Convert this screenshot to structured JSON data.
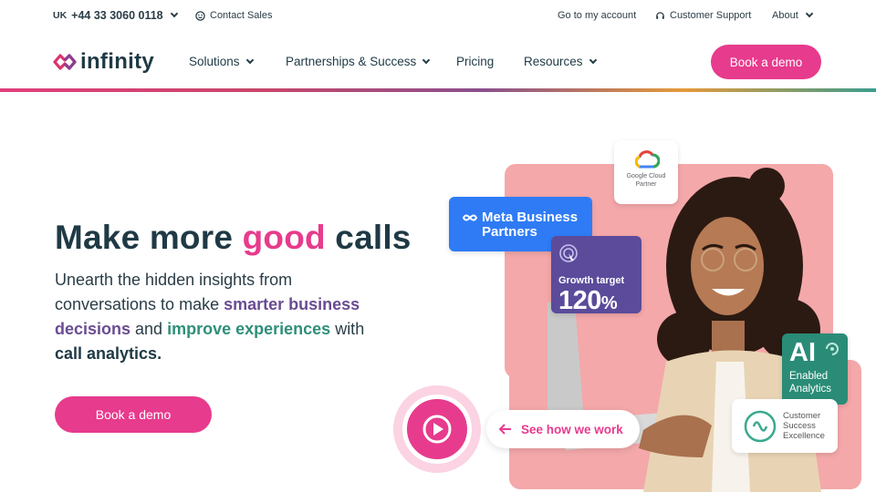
{
  "topbar": {
    "country": "UK",
    "phone": "+44 33 3060 0118",
    "contact_sales": "Contact Sales",
    "account": "Go to my account",
    "support": "Customer Support",
    "about": "About"
  },
  "nav": {
    "logo_text": "infinity",
    "items": [
      {
        "label": "Solutions"
      },
      {
        "label": "Partnerships & Success"
      },
      {
        "label": "Pricing"
      },
      {
        "label": "Resources"
      }
    ],
    "cta": "Book a demo"
  },
  "hero": {
    "title_a": "Make more ",
    "title_b": "good",
    "title_c": " calls",
    "body_1": "Unearth the hidden insights from conversations to make ",
    "body_2": "smarter business decisions",
    "body_3": " and ",
    "body_4": "improve experiences",
    "body_5": " with ",
    "body_6": "call analytics.",
    "cta": "Book a demo"
  },
  "collage": {
    "google_cloud_1": "Google Cloud",
    "google_cloud_2": "Partner",
    "meta_1": "Meta Business",
    "meta_2": "Partners",
    "growth_label": "Growth target",
    "growth_value": "120",
    "growth_unit": "%",
    "ai_big": "AI",
    "ai_line1": "Enabled",
    "ai_line2": "Analytics",
    "cse_1": "Customer",
    "cse_2": "Success",
    "cse_3": "Excellence",
    "video_cta": "See how we work"
  },
  "colors": {
    "brand_pink": "#e73b8d",
    "navy": "#1f3a45",
    "purple": "#6a4c93",
    "green": "#2f8f7a",
    "meta_blue": "#2f7bf5",
    "growth_purple": "#5b4b9a",
    "ai_green": "#2a8c77",
    "blush": "#f4a8aa"
  }
}
